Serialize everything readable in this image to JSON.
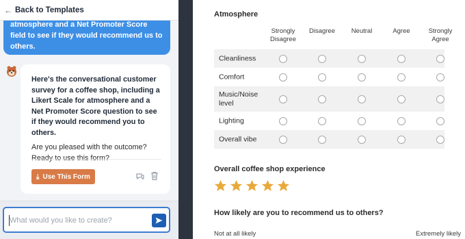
{
  "header": {
    "back_label": "Back to Templates"
  },
  "chat": {
    "user_message": "atmosphere and a Net Promoter Score field to see if they would recommend us to others.",
    "bot_message": "Here's the conversational customer survey for a coffee shop, including a Likert Scale for atmosphere and a Net Promoter Score question to see if they would recommend you to others.",
    "bot_question": "Are you pleased with the outcome? Ready to use this form?",
    "use_form_label": "Use This Form",
    "composer_placeholder": "What would you like to create?",
    "composer_value": ""
  },
  "form": {
    "likert": {
      "title": "Atmosphere",
      "columns": [
        "Strongly Disagree",
        "Disagree",
        "Neutral",
        "Agree",
        "Strongly Agree"
      ],
      "rows": [
        "Cleanliness",
        "Comfort",
        "Music/Noise level",
        "Lighting",
        "Overall vibe"
      ]
    },
    "rating": {
      "title": "Overall coffee shop experience",
      "stars_filled": 5,
      "stars_total": 5,
      "star_color": "#e8a93a"
    },
    "nps": {
      "title": "How likely are you to recommend us to others?",
      "low_label": "Not at all likely",
      "high_label": "Extremely likely"
    }
  },
  "colors": {
    "user_bubble": "#3d8fe6",
    "use_button": "#d87b46",
    "send_button": "#1d5fb3",
    "splitter": "#2e3340"
  }
}
